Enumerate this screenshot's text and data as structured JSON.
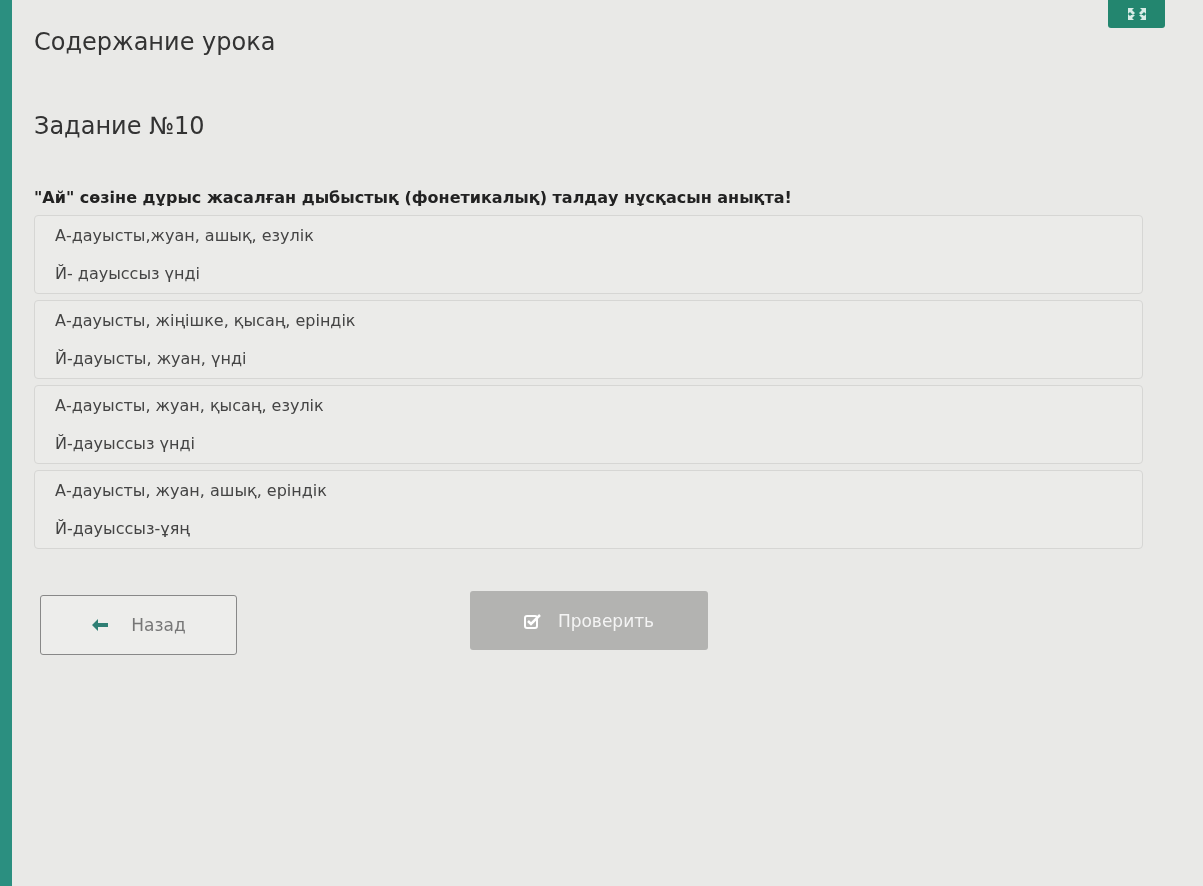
{
  "header": {
    "title": "Содержание урока"
  },
  "task": {
    "title": "Задание №10",
    "question": "\"Ай\" сөзіне дұрыс жасалған дыбыстық (фонетикалық) талдау нұсқасын анықта!"
  },
  "options": [
    {
      "lines": [
        "А-дауысты,жуан, ашық, езулік",
        "Й- дауыссыз үнді"
      ],
      "selected": false
    },
    {
      "lines": [
        "А-дауысты, жіңішке, қысаң, еріндік",
        "Й-дауысты, жуан, үнді"
      ],
      "selected": false
    },
    {
      "lines": [
        "А-дауысты, жуан, қысаң, езулік",
        "Й-дауыссыз үнді"
      ],
      "selected": false
    },
    {
      "lines": [
        "А-дауысты, жуан, ашық, еріндік",
        "Й-дауыссыз-ұяң"
      ],
      "selected": false
    }
  ],
  "buttons": {
    "back": {
      "label": "Назад"
    },
    "check": {
      "label": "Проверить",
      "disabled": true
    }
  }
}
